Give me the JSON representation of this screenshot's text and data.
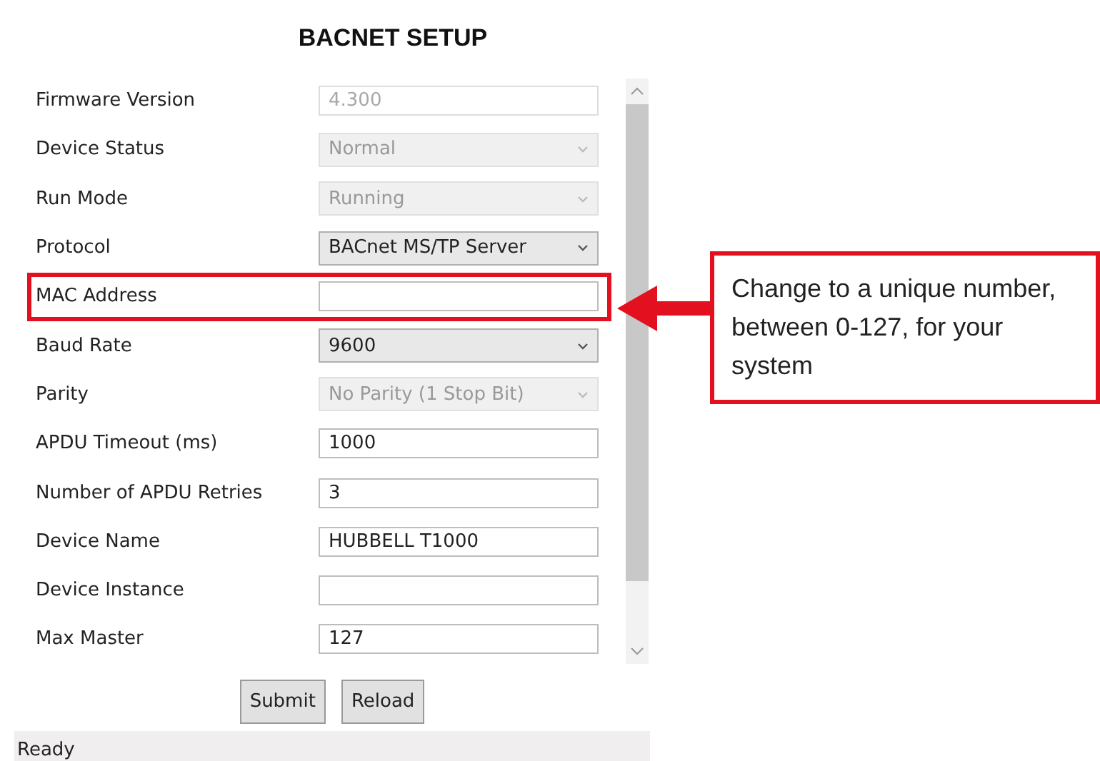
{
  "title": "BACNET SETUP",
  "rows": [
    {
      "label": "Firmware Version",
      "kind": "text",
      "value": "4.300",
      "disabled": true,
      "highlighted": false
    },
    {
      "label": "Device Status",
      "kind": "select",
      "value": "Normal",
      "disabled": true,
      "highlighted": false
    },
    {
      "label": "Run Mode",
      "kind": "select",
      "value": "Running",
      "disabled": true,
      "highlighted": false
    },
    {
      "label": "Protocol",
      "kind": "select",
      "value": "BACnet MS/TP Server",
      "disabled": false,
      "highlighted": false
    },
    {
      "label": "MAC Address",
      "kind": "text",
      "disabled": false,
      "highlighted": true
    },
    {
      "label": "Baud Rate",
      "kind": "select",
      "value": "9600",
      "disabled": false,
      "highlighted": false
    },
    {
      "label": "Parity",
      "kind": "select",
      "value": "No Parity (1 Stop Bit)",
      "disabled": true,
      "highlighted": false
    },
    {
      "label": "APDU Timeout (ms)",
      "kind": "text",
      "value": "1000",
      "disabled": false,
      "highlighted": false
    },
    {
      "label": "Number of APDU Retries",
      "kind": "text",
      "value": "3",
      "disabled": false,
      "highlighted": false
    },
    {
      "label": "Device Name",
      "kind": "text",
      "value": "HUBBELL T1000",
      "disabled": false,
      "highlighted": false
    },
    {
      "label": "Device Instance",
      "kind": "text",
      "disabled": false,
      "highlighted": false
    },
    {
      "label": "Max Master",
      "kind": "text",
      "value": "127",
      "disabled": false,
      "highlighted": false
    }
  ],
  "buttons": [
    "Submit",
    "Reload"
  ],
  "status_bar": "Ready",
  "callout": {
    "text": "Change to a unique number, between 0-127, for your system"
  }
}
